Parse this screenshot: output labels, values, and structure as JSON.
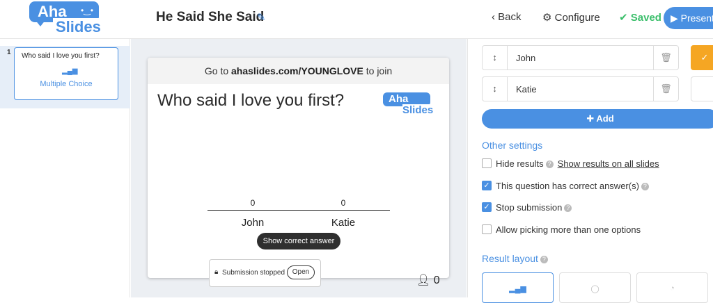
{
  "app": {
    "logo_top": "Aha",
    "logo_bottom": "Slides",
    "presentation_title": "He Said She Said"
  },
  "header": {
    "back_label": "Back",
    "configure_label": "Configure",
    "saved_label": "Saved",
    "present_label": "Present"
  },
  "slides_panel": {
    "slides": [
      {
        "number": "1",
        "question": "Who said I love you first?",
        "type": "Multiple Choice"
      }
    ]
  },
  "slide": {
    "join_prefix": "Go to ",
    "join_url": "ahaslides.com/YOUNGLOVE",
    "join_suffix": " to join",
    "question": "Who said I love you first?",
    "logo_top": "Aha",
    "logo_bottom": "Slides",
    "show_correct_label": "Show correct answer",
    "submission_text": "Submission stopped",
    "open_label": "Open",
    "response_count": "0"
  },
  "chart_data": {
    "type": "bar",
    "categories": [
      "John",
      "Katie"
    ],
    "values": [
      0,
      0
    ]
  },
  "options": {
    "items": [
      {
        "text": "John",
        "correct": true
      },
      {
        "text": "Katie",
        "correct": false
      }
    ],
    "add_label": "Add"
  },
  "other_settings": {
    "title": "Other settings",
    "hide_results": {
      "label": "Hide results",
      "checked": false,
      "link": "Show results on all slides"
    },
    "has_correct": {
      "label": "This question has correct answer(s)",
      "checked": true
    },
    "stop_submission": {
      "label": "Stop submission",
      "checked": true
    },
    "allow_multiple": {
      "label": "Allow picking more than one options",
      "checked": false
    }
  },
  "result_layout": {
    "title": "Result layout",
    "options": [
      "bar",
      "donut",
      "pie"
    ],
    "selected": "bar"
  },
  "colors": {
    "accent": "#4a90e2",
    "saved": "#3cbf6c",
    "correct": "#f5a623"
  }
}
